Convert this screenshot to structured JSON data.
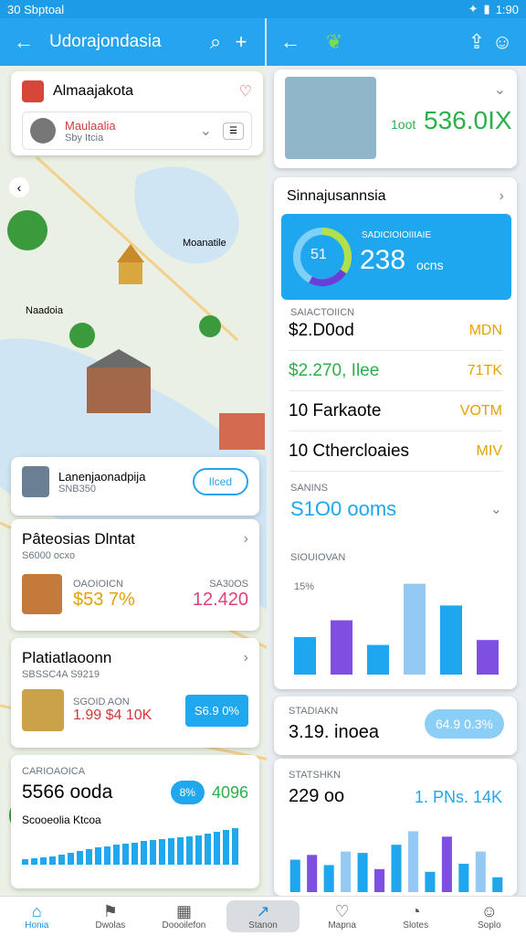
{
  "status": {
    "left": "30 Sbptoal",
    "right": "1:90"
  },
  "left_appbar": {
    "title": "Udorajondasia"
  },
  "search_card": {
    "title": "Almaajakota",
    "item_title": "Maulaalia",
    "item_sub": "Sby Itcia"
  },
  "map_labels": {
    "a": "Moanatile",
    "b": "Naadoia"
  },
  "hotel_card": {
    "title": "Lanenjaonadpija",
    "sub": "SNB350",
    "button": "Ilced"
  },
  "pattern_card": {
    "title": "Pâteosias Dlntat",
    "sub": "S6000 ocxo",
    "col1_label": "OAOIOICN",
    "col1_value": "$53 7%",
    "col2_label": "SA30OS",
    "col2_value": "12.420"
  },
  "plat_card": {
    "title": "Platiatlaoonn",
    "sub": "SBSSC4A S9219",
    "item_label": "SGOID AON",
    "item_value": "1.99 $4 10K",
    "badge": "S6.9 0%"
  },
  "camp_card": {
    "label": "CARIOAOICA",
    "value": "5566 ooda",
    "pill": "8%",
    "pct": "4096",
    "footer": "Scooeolia Ktcoa"
  },
  "right_appbar": {},
  "top_card": {
    "ratio_label": "1oot",
    "ratio_value": "536.0IX"
  },
  "summary_card": {
    "title": "Sinnajusannsia",
    "hero_label": "SADICIOIOIIIAIE",
    "hero_value": "238",
    "hero_unit": "ocns",
    "dial_value": "51",
    "section_label": "SAIACTOIICN",
    "rows": [
      {
        "label": "$2.D0od",
        "value": "MDN"
      },
      {
        "label": "$2.270, Ilee",
        "value": "71TK"
      },
      {
        "label": "10 Farkaote",
        "value": "VOTM"
      },
      {
        "label": "10 Cthercloaies",
        "value": "MIV"
      }
    ],
    "sales_label": "SANINS",
    "sales_value": "S1O0 ooms",
    "chart_title": "SIOUIOVAN",
    "chart_pct": "15%"
  },
  "stat_card1": {
    "label": "STADIAKN",
    "value": "3.19. inoea",
    "pill": "64.9 0.3%"
  },
  "stat_card2": {
    "label": "STATSHKN",
    "value": "229 oo",
    "right": "1. PNs. 14K"
  },
  "bottom_nav": [
    "Honia",
    "Dwolas",
    "Doooilefon",
    "Stanon",
    "Mapna",
    "Slotes",
    "Soplo"
  ],
  "chart_data": [
    {
      "type": "bar",
      "series": [
        {
          "values": [
            38,
            55,
            30,
            92,
            70,
            35
          ]
        }
      ]
    },
    {
      "type": "bar",
      "series": [
        {
          "values": [
            48,
            55,
            40,
            60,
            58,
            34,
            70,
            90,
            30,
            82,
            42,
            60,
            22
          ]
        }
      ]
    }
  ],
  "colors": {
    "accent": "#27a4ee",
    "gold": "#e2a200",
    "green": "#2bb04a",
    "pink": "#e0407a"
  }
}
